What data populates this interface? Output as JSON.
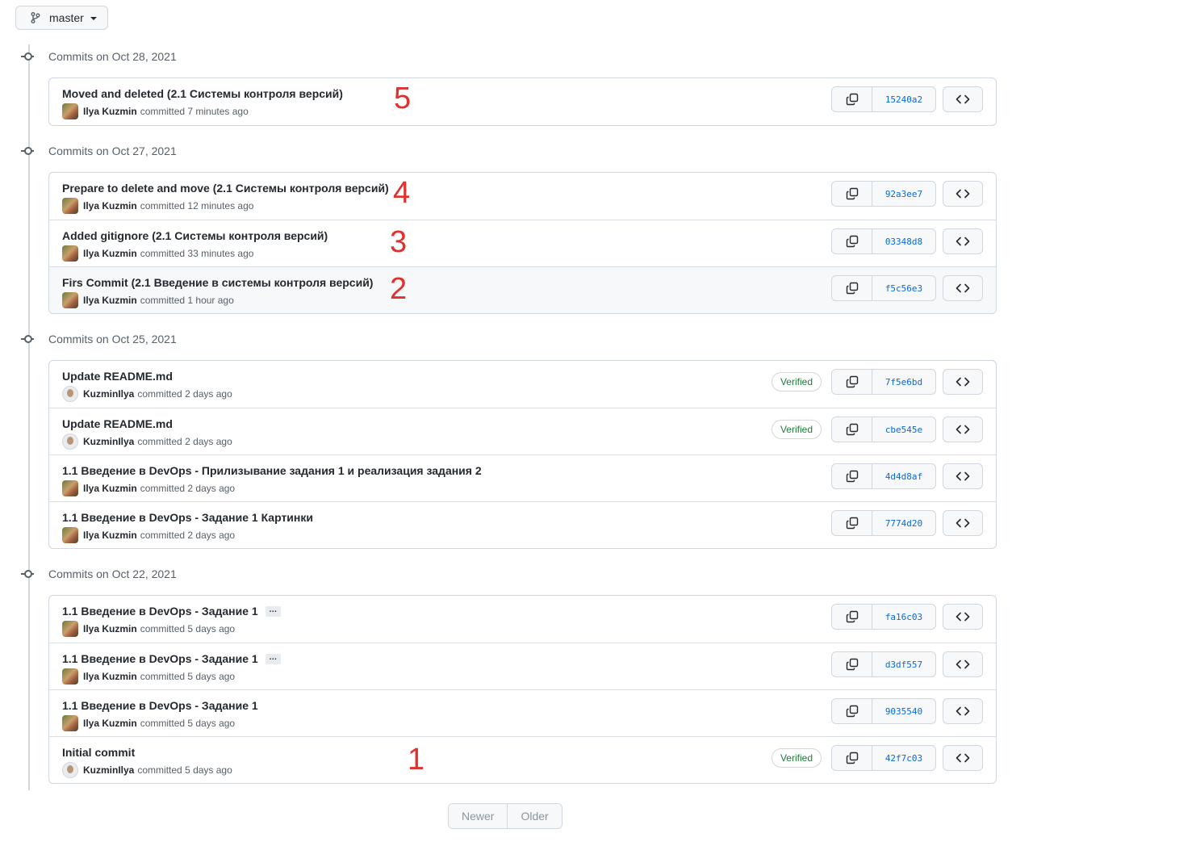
{
  "branch": {
    "label": "master",
    "icon": "git-branch-icon"
  },
  "groups": [
    {
      "title": "Commits on Oct 28, 2021",
      "commits": [
        {
          "message": "Moved and deleted (2.1 Системы контроля версий)",
          "author": "Ilya Kuzmin",
          "action": "committed",
          "time": "7 minutes ago",
          "sha": "15240a2",
          "verified": false,
          "annotation": "5"
        }
      ]
    },
    {
      "title": "Commits on Oct 27, 2021",
      "commits": [
        {
          "message": "Prepare to delete and move (2.1 Системы контроля версий)",
          "author": "Ilya Kuzmin",
          "action": "committed",
          "time": "12 minutes ago",
          "sha": "92a3ee7",
          "verified": false,
          "annotation": "4"
        },
        {
          "message": "Added gitignore (2.1 Системы контроля версий)",
          "author": "Ilya Kuzmin",
          "action": "committed",
          "time": "33 minutes ago",
          "sha": "03348d8",
          "verified": false,
          "annotation": "3"
        },
        {
          "message": "Firs Commit (2.1 Введение в системы контроля версий)",
          "author": "Ilya Kuzmin",
          "action": "committed",
          "time": "1 hour ago",
          "sha": "f5c56e3",
          "verified": false,
          "annotation": "2"
        }
      ]
    },
    {
      "title": "Commits on Oct 25, 2021",
      "commits": [
        {
          "message": "Update README.md",
          "author": "KuzminIlya",
          "action": "committed",
          "time": "2 days ago",
          "sha": "7f5e6bd",
          "verified": true,
          "verified_label": "Verified"
        },
        {
          "message": "Update README.md",
          "author": "KuzminIlya",
          "action": "committed",
          "time": "2 days ago",
          "sha": "cbe545e",
          "verified": true,
          "verified_label": "Verified"
        },
        {
          "message": "1.1 Введение в DevOps - Прилизывание задания 1 и реализация задания 2",
          "author": "Ilya Kuzmin",
          "action": "committed",
          "time": "2 days ago",
          "sha": "4d4d8af",
          "verified": false
        },
        {
          "message": "1.1 Введение в DevOps - Задание 1 Картинки",
          "author": "Ilya Kuzmin",
          "action": "committed",
          "time": "2 days ago",
          "sha": "7774d20",
          "verified": false
        }
      ]
    },
    {
      "title": "Commits on Oct 22, 2021",
      "commits": [
        {
          "message": "1.1 Введение в DevOps - Задание 1",
          "author": "Ilya Kuzmin",
          "action": "committed",
          "time": "5 days ago",
          "sha": "fa16c03",
          "verified": false,
          "has_more": true,
          "more_label": "…"
        },
        {
          "message": "1.1 Введение в DevOps - Задание 1",
          "author": "Ilya Kuzmin",
          "action": "committed",
          "time": "5 days ago",
          "sha": "d3df557",
          "verified": false,
          "has_more": true,
          "more_label": "…"
        },
        {
          "message": "1.1 Введение в DevOps - Задание 1",
          "author": "Ilya Kuzmin",
          "action": "committed",
          "time": "5 days ago",
          "sha": "9035540",
          "verified": false
        },
        {
          "message": "Initial commit",
          "author": "KuzminIlya",
          "action": "committed",
          "time": "5 days ago",
          "sha": "42f7c03",
          "verified": true,
          "verified_label": "Verified",
          "annotation": "1"
        }
      ]
    }
  ],
  "pagination": {
    "newer": "Newer",
    "older": "Older"
  },
  "colors": {
    "link": "#0969da",
    "verified": "#1a7f37",
    "annotation": "#e0312f",
    "border": "#d0d7de"
  }
}
